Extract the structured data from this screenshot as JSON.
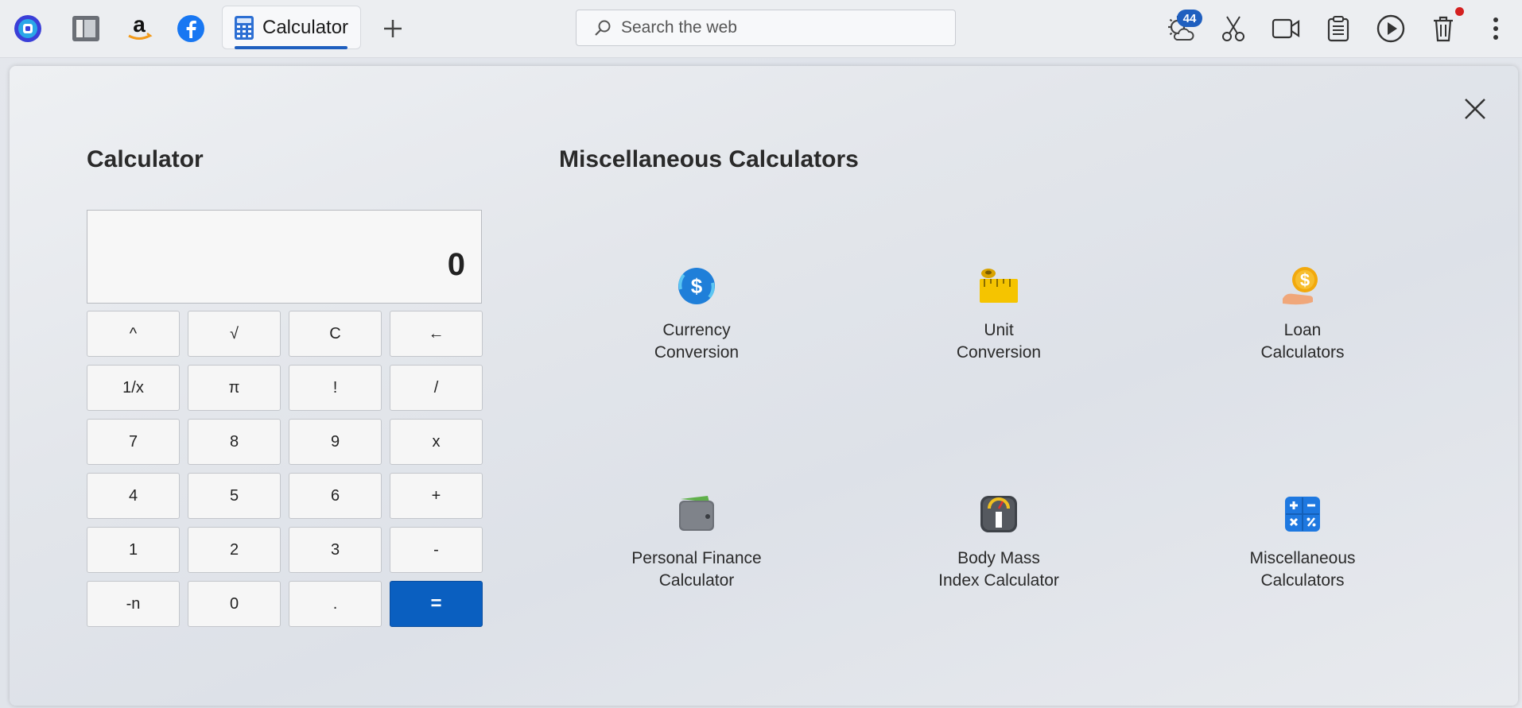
{
  "taskbar": {
    "active_tab_label": "Calculator",
    "search_placeholder": "Search the web",
    "notification_count": "44",
    "icons": [
      "app-launcher-icon",
      "files-icon",
      "amazon-icon",
      "facebook-icon",
      "calculator-icon",
      "new-tab-icon",
      "weather-icon",
      "scissors-icon",
      "video-icon",
      "clipboard-icon",
      "play-icon",
      "trash-icon",
      "more-icon"
    ]
  },
  "calculator": {
    "title": "Calculator",
    "display_value": "0",
    "keys": [
      "^",
      "√",
      "C",
      "←",
      "1/x",
      "π",
      "!",
      "/",
      "7",
      "8",
      "9",
      "x",
      "4",
      "5",
      "6",
      "+",
      "1",
      "2",
      "3",
      "-",
      "-n",
      "0",
      ".",
      "="
    ]
  },
  "misc": {
    "title": "Miscellaneous Calculators",
    "tiles": [
      {
        "line1": "Currency",
        "line2": "Conversion",
        "icon": "currency-icon"
      },
      {
        "line1": "Unit",
        "line2": "Conversion",
        "icon": "ruler-icon"
      },
      {
        "line1": "Loan",
        "line2": "Calculators",
        "icon": "loan-icon"
      },
      {
        "line1": "Personal Finance",
        "line2": "Calculator",
        "icon": "wallet-icon"
      },
      {
        "line1": "Body Mass",
        "line2": "Index Calculator",
        "icon": "scale-icon"
      },
      {
        "line1": "Miscellaneous",
        "line2": "Calculators",
        "icon": "math-icon"
      }
    ]
  },
  "colors": {
    "accent": "#0a5fc0",
    "badge": "#1f5fbf",
    "notify_dot": "#d42020"
  }
}
